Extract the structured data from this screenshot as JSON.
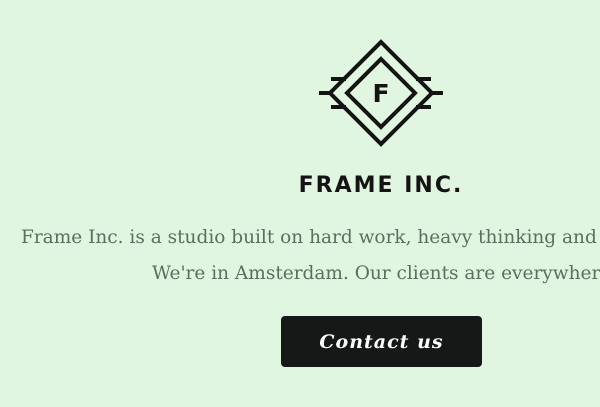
{
  "logo": {
    "icon": "frame-diamond-logo",
    "monogram": "F"
  },
  "brand": {
    "name": "FRAME INC."
  },
  "intro": {
    "line1": "Frame Inc.  is a studio built on hard work,  heavy thinking and smart ideas.",
    "line2": "We're in Amsterdam.  Our clients are everywhere."
  },
  "cta": {
    "label": "Contact us"
  },
  "colors": {
    "background": "#e1f6e1",
    "text_dark": "#141414",
    "text_body": "#59705c",
    "button_bg": "#151816",
    "button_text": "#ffffff"
  }
}
